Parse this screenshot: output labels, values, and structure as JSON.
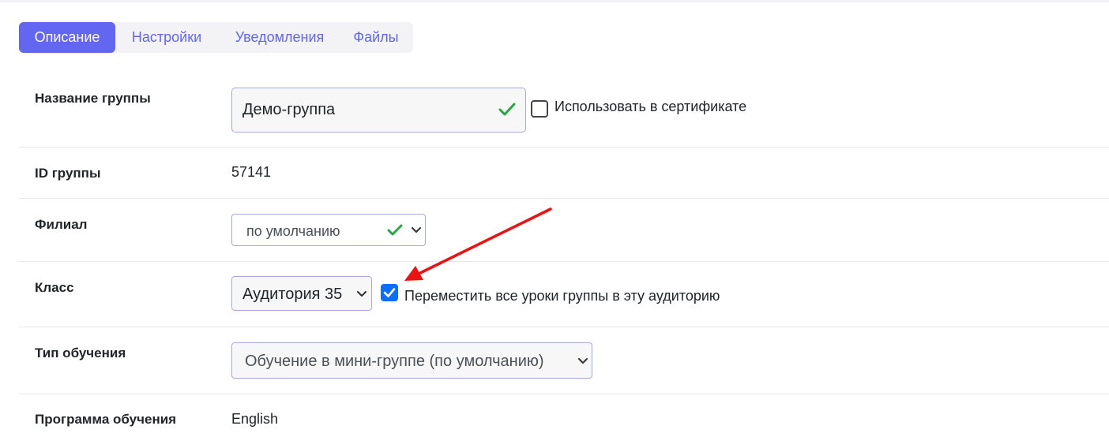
{
  "tabs": [
    {
      "label": "Описание",
      "active": true
    },
    {
      "label": "Настройки",
      "active": false
    },
    {
      "label": "Уведомления",
      "active": false
    },
    {
      "label": "Файлы",
      "active": false
    }
  ],
  "rows": {
    "group_name": {
      "label": "Название группы",
      "value": "Демо-группа",
      "certificate_checkbox_label": "Использовать в сертификате",
      "certificate_checked": false
    },
    "group_id": {
      "label": "ID группы",
      "value": "57141"
    },
    "branch": {
      "label": "Филиал",
      "selected": "по умолчанию"
    },
    "class": {
      "label": "Класс",
      "selected": "Аудитория 35",
      "move_checkbox_label": "Переместить все уроки группы в эту аудиторию",
      "move_checked": true
    },
    "learning_type": {
      "label": "Тип обучения",
      "selected": "Обучение в мини-группе (по умолчанию)"
    },
    "program": {
      "label": "Программа обучения",
      "value": "English"
    }
  },
  "colors": {
    "accent": "#6366f1",
    "valid_check": "#28a745",
    "checkbox_blue": "#0d6efd",
    "annotation_arrow": "#ee1111"
  },
  "icons": {
    "valid": "check-icon",
    "dropdown": "chevron-down-icon",
    "annotation": "red-arrow"
  }
}
